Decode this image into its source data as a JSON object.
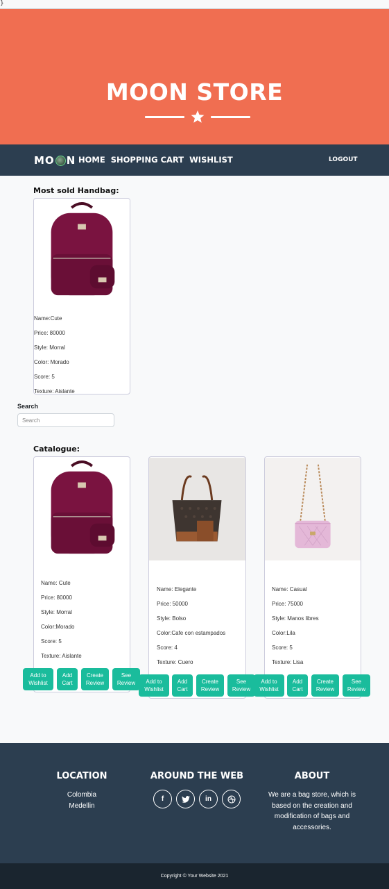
{
  "stray_char": "}",
  "header": {
    "title": "MOON STORE"
  },
  "navbar": {
    "brand_left": "MO",
    "brand_right": "N",
    "links": [
      "HOME",
      "SHOPPING CART",
      "WISHLIST"
    ],
    "logout": "LOGOUT"
  },
  "most_sold": {
    "title": "Most sold Handbag:",
    "fields": [
      "Name:Cute",
      "Price: 80000",
      "Style: Morral",
      "Color: Morado",
      "Score: 5",
      "Texture: Aislante"
    ]
  },
  "search": {
    "label": "Search",
    "placeholder": "Search"
  },
  "catalogue": {
    "title": "Catalogue:",
    "items": [
      {
        "fields": [
          "Name: Cute",
          "Price: 80000",
          "Style: Morral",
          "Color:Morado",
          "Score: 5",
          "Texture: Aislante"
        ]
      },
      {
        "fields": [
          "Name: Elegante",
          "Price: 50000",
          "Style: Bolso",
          "Color:Cafe con estampados",
          "Score: 4",
          "Texture: Cuero"
        ]
      },
      {
        "fields": [
          "Name: Casual",
          "Price: 75000",
          "Style: Manos libres",
          "Color:Lila",
          "Score: 5",
          "Texture: Lisa"
        ]
      }
    ],
    "buttons": {
      "wishlist": "Add to Wishlist",
      "cart": "Add Cart",
      "create_review": "Create Review",
      "see_review": "See Review"
    }
  },
  "footer": {
    "location": {
      "title": "LOCATION",
      "line1": "Colombia",
      "line2": "Medellin"
    },
    "web": {
      "title": "AROUND THE WEB",
      "icons": [
        "facebook-icon",
        "twitter-icon",
        "linkedin-icon",
        "dribbble-icon"
      ]
    },
    "about": {
      "title": "ABOUT",
      "text": "We are a bag store, which is based on the creation and modification of bags and accessories."
    }
  },
  "copyright": "Copyright © Your Website 2021",
  "colors": {
    "header": "#f06e51",
    "navbar": "#2c3e50",
    "button": "#1abc9c",
    "footer": "#2c3e50",
    "copyright": "#1a252f"
  }
}
